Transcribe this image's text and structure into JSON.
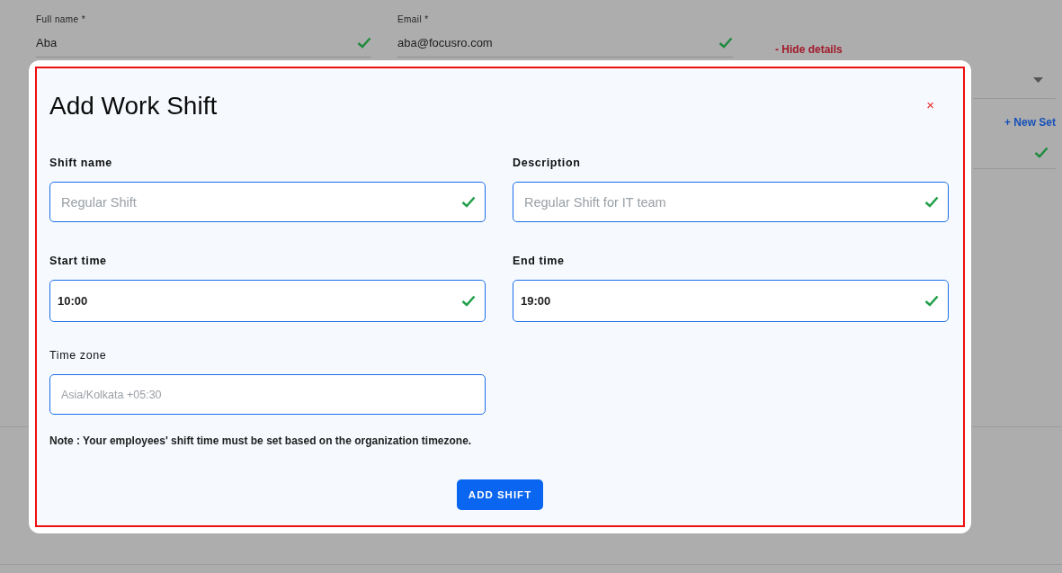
{
  "background_form": {
    "fields": [
      {
        "label": "Full name *",
        "value": "Aba",
        "valid": true
      },
      {
        "label": "Email *",
        "value": "aba@focusro.com",
        "valid": true
      }
    ],
    "hide_details_link": "- Hide details",
    "new_set_link": "+ New Set",
    "side_field": {
      "valid": true
    }
  },
  "dialog": {
    "title": "Add Work Shift",
    "close": "×",
    "fields": [
      {
        "kind": "text",
        "label": "Shift name",
        "placeholder": "Regular Shift",
        "valid": true
      },
      {
        "kind": "text",
        "label": "Description",
        "placeholder": "Regular Shift for IT team",
        "valid": true
      },
      {
        "kind": "time",
        "label": "Start time",
        "value": "10:00",
        "valid": true
      },
      {
        "kind": "time",
        "label": "End time",
        "value": "19:00",
        "valid": true
      },
      {
        "kind": "select",
        "label": "Time zone",
        "placeholder": "Asia/Kolkata +05:30",
        "valid": false
      }
    ],
    "note": "Note : Your employees' shift time must be set based on the organization timezone.",
    "submit_button": "ADD SHIFT"
  }
}
